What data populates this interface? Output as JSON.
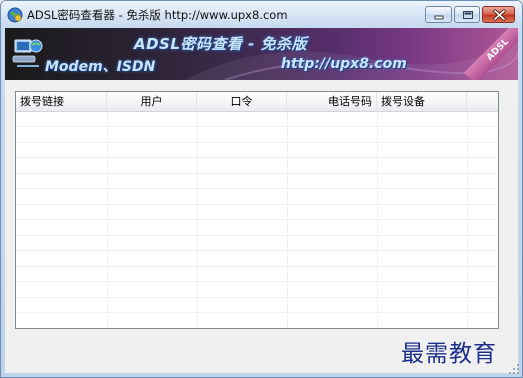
{
  "window": {
    "title": "ADSL密码查看器 - 免杀版  http://www.upx8.com"
  },
  "banner": {
    "title": "ADSL密码查看 - 免杀版",
    "left_text": "Modem、ISDN",
    "url_text": "http://upx8.com",
    "ribbon_text": "ADSL"
  },
  "table": {
    "columns": [
      "拨号链接",
      "用户",
      "口令",
      "电话号码",
      "拨号设备"
    ],
    "rows": []
  },
  "watermark": "最需教育",
  "colors": {
    "window_border": "#6b8fb8",
    "banner_start": "#1a1a1a",
    "banner_end": "#b05896",
    "close_button": "#c23a1f",
    "watermark": "#1b2f8a"
  }
}
